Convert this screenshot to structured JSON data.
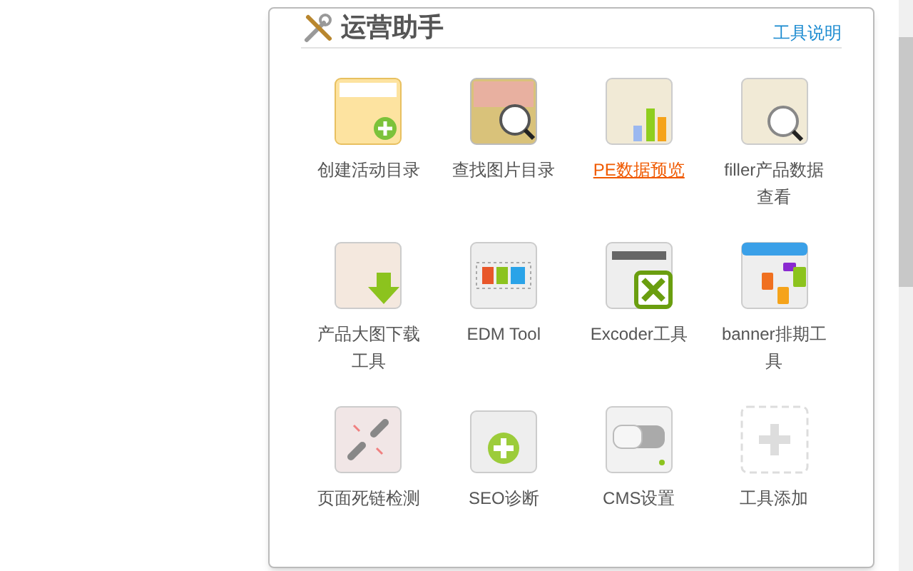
{
  "popup": {
    "title": "运营助手",
    "help_link": "工具说明",
    "tools": [
      {
        "label": "创建活动目录",
        "selected": false
      },
      {
        "label": "查找图片目录",
        "selected": false
      },
      {
        "label": "PE数据预览",
        "selected": true
      },
      {
        "label": "filler产品数据查看",
        "selected": false
      },
      {
        "label": "产品大图下载工具",
        "selected": false
      },
      {
        "label": "EDM Tool",
        "selected": false
      },
      {
        "label": "Excoder工具",
        "selected": false
      },
      {
        "label": "banner排期工具",
        "selected": false
      },
      {
        "label": "页面死链检测",
        "selected": false
      },
      {
        "label": "SEO诊断",
        "selected": false
      },
      {
        "label": "CMS设置",
        "selected": false
      },
      {
        "label": "工具添加",
        "selected": false
      }
    ]
  }
}
